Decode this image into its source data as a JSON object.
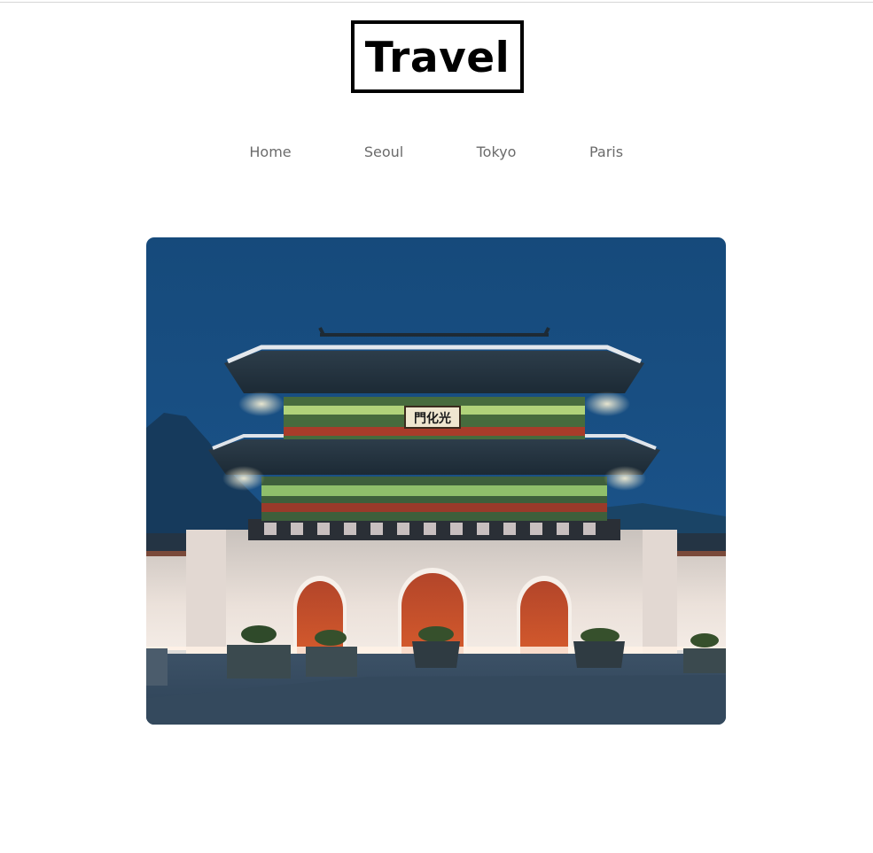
{
  "header": {
    "logo_text": "Travel"
  },
  "nav": {
    "items": [
      {
        "label": "Home"
      },
      {
        "label": "Seoul"
      },
      {
        "label": "Tokyo"
      },
      {
        "label": "Paris"
      }
    ]
  },
  "hero": {
    "image_subject": "palace-gate-at-night",
    "sign_text": "門化光"
  },
  "colors": {
    "nav_text": "#6b6b6b",
    "logo_border": "#000000",
    "sky": "#174e80"
  }
}
